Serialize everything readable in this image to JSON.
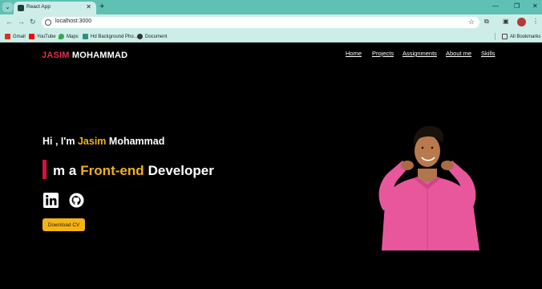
{
  "browser": {
    "tab_title": "React App",
    "url": "localhost:3000",
    "bookmarks": [
      "Gmail",
      "YouTube",
      "Maps",
      "Hd Background Pho...",
      "Document"
    ],
    "all_bookmarks": "All Bookmarks"
  },
  "site": {
    "logo_first": "JASIM",
    "logo_last": "MOHAMMAD",
    "nav": [
      "Home",
      "Projects",
      "Assignments",
      "About me",
      "Skills"
    ],
    "greeting": {
      "prefix": "Hi , I'm",
      "name": "Jasim",
      "surname": "Mohammad"
    },
    "role": {
      "prefix": "m a",
      "highlight": "Front-end",
      "suffix": "Developer"
    },
    "download_label": "Download CV",
    "social": [
      "linkedin-icon",
      "github-icon"
    ]
  },
  "colors": {
    "accent_red": "#e52e4a",
    "accent_gold": "#f2b01e",
    "chrome_teal": "#5fc1b4"
  }
}
